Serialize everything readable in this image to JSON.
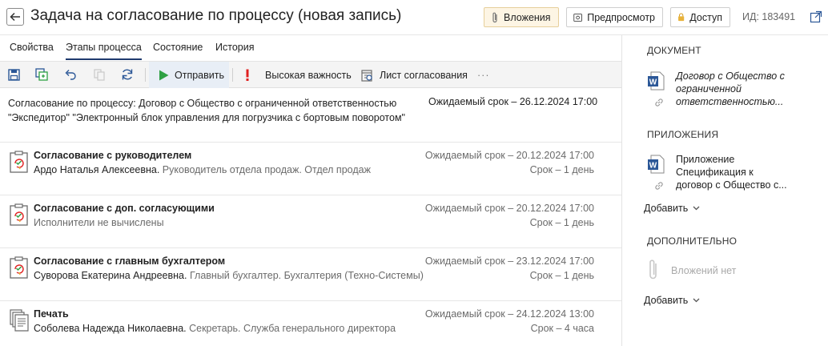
{
  "header": {
    "title": "Задача на согласование по процессу (новая запись)",
    "attachments_label": "Вложения",
    "preview_label": "Предпросмотр",
    "access_label": "Доступ",
    "id_text": "ИД: 183491"
  },
  "tabs": [
    {
      "label": "Свойства",
      "active": false
    },
    {
      "label": "Этапы процесса",
      "active": true
    },
    {
      "label": "Состояние",
      "active": false
    },
    {
      "label": "История",
      "active": false
    }
  ],
  "toolbar": {
    "send_label": "Отправить",
    "importance_label": "Высокая важность",
    "approval_sheet_label": "Лист согласования",
    "more_label": "···"
  },
  "summary": {
    "text_line1": "Согласование по процессу: Договор с Общество с ограниченной ответственностью",
    "text_line2": "\"Экспедитор\" \"Электронный блок управления для погрузчика с бортовым поворотом\"",
    "due": "Ожидаемый срок – 26.12.2024 17:00"
  },
  "stages": [
    {
      "title": "Согласование с руководителем",
      "who": "Ардо Наталья Алексеевна.",
      "role": " Руководитель отдела продаж. Отдел продаж",
      "due": "Ожидаемый срок – 20.12.2024 17:00",
      "term": "Срок – 1 день",
      "icon": "approval-icon"
    },
    {
      "title": "Согласование с доп. согласующими",
      "who": "",
      "role": "Исполнители не вычислены",
      "due": "Ожидаемый срок – 20.12.2024 17:00",
      "term": "Срок – 1 день",
      "icon": "approval-icon"
    },
    {
      "title": "Согласование с главным бухгалтером",
      "who": "Суворова Екатерина Андреевна.",
      "role": " Главный бухгалтер. Бухгалтерия (Техно-Системы)",
      "due": "Ожидаемый срок – 23.12.2024 17:00",
      "term": "Срок – 1 день",
      "icon": "approval-icon"
    },
    {
      "title": "Печать",
      "who": "Соболева Надежда Николаевна.",
      "role": " Секретарь. Служба генерального директора",
      "due": "Ожидаемый срок – 24.12.2024 13:00",
      "term": "Срок – 4 часа",
      "icon": "print-documents-icon"
    }
  ],
  "panel": {
    "document_head": "ДОКУМЕНТ",
    "document_lines": [
      "Договор с Общество с",
      "ограниченной",
      "ответственностью..."
    ],
    "attachments_head": "ПРИЛОЖЕНИЯ",
    "attachment_lines": [
      "Приложение",
      "Спецификация к",
      "договор с Общество с..."
    ],
    "add_label_1": "Добавить",
    "extra_head": "ДОПОЛНИТЕЛЬНО",
    "no_attachments": "Вложений нет",
    "add_label_2": "Добавить"
  },
  "colors": {
    "accent": "#1f3a6e",
    "word_blue": "#2b5797",
    "send_green": "#2ea043",
    "importance_red": "#e02020",
    "toolbar_bg": "#f4f4f4",
    "attach_bg": "#fdf5e4"
  }
}
